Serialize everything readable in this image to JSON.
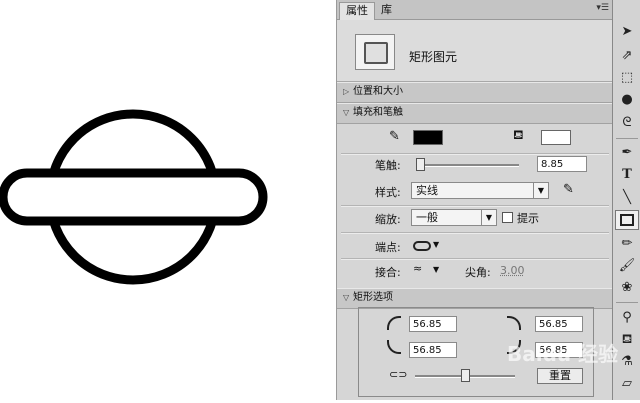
{
  "tabs": [
    {
      "label": "属性"
    },
    {
      "label": "库"
    }
  ],
  "header": {
    "element_type": "矩形图元"
  },
  "sections": {
    "position_size": "位置和大小",
    "fill_stroke": "填充和笔触",
    "rect_options": "矩形选项"
  },
  "fill_stroke": {
    "stroke_color": "#000000",
    "fill_color": "#ffffff",
    "stroke_label": "笔触:",
    "stroke_value": "8.85",
    "style_label": "样式:",
    "style_value": "实线",
    "scale_label": "缩放:",
    "scale_value": "一般",
    "hint_label": "提示",
    "cap_label": "端点:",
    "join_label": "接合:",
    "miter_label": "尖角:",
    "miter_value": "3.00"
  },
  "rect_options": {
    "corner_tl": "56.85",
    "corner_tr": "56.85",
    "corner_bl": "56.85",
    "corner_br": "56.85",
    "reset_label": "重置"
  },
  "toolbar": {
    "tools": [
      "selection-tool",
      "subselection-tool",
      "free-transform-tool",
      "3d-rotation-tool",
      "lasso-tool",
      "pen-tool",
      "text-tool",
      "line-tool",
      "rectangle-tool",
      "pencil-tool",
      "brush-tool",
      "deco-tool",
      "bone-tool",
      "paint-bucket-tool",
      "eyedropper-tool",
      "eraser-tool"
    ],
    "selected": "rectangle-tool"
  },
  "watermark": "Baidu 经验"
}
